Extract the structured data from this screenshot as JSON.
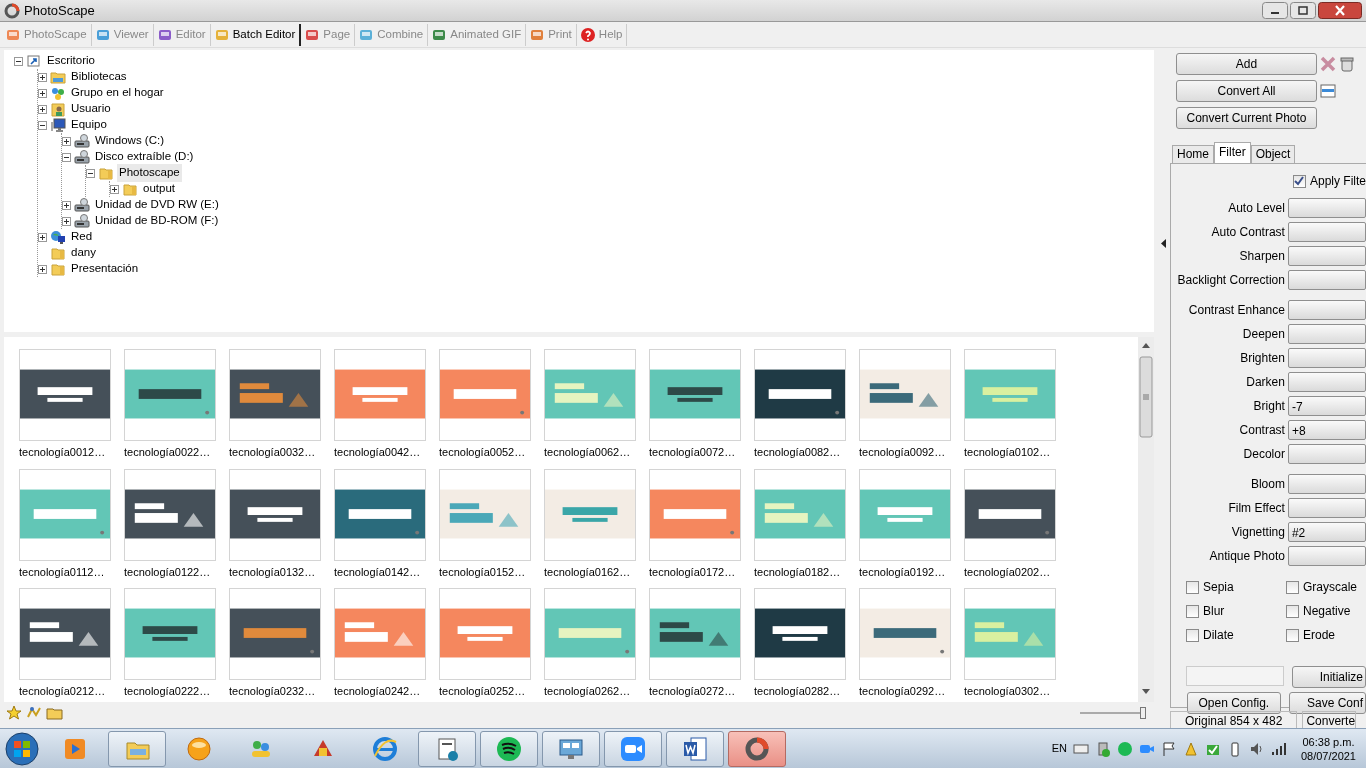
{
  "window": {
    "title": "PhotoScape"
  },
  "modules": [
    {
      "label": "PhotoScape",
      "selected": false
    },
    {
      "label": "Viewer",
      "selected": false
    },
    {
      "label": "Editor",
      "selected": false
    },
    {
      "label": "Batch Editor",
      "selected": true
    },
    {
      "label": "Page",
      "selected": false
    },
    {
      "label": "Combine",
      "selected": false
    },
    {
      "label": "Animated GIF",
      "selected": false
    },
    {
      "label": "Print",
      "selected": false
    },
    {
      "label": "Help",
      "selected": false
    }
  ],
  "tree": [
    {
      "label": "Escritorio",
      "kind": "desktop",
      "expanded": true,
      "selected": false,
      "children": [
        {
          "label": "Bibliotecas",
          "kind": "library",
          "expanded": false,
          "selected": false
        },
        {
          "label": "Grupo en el hogar",
          "kind": "homegroup",
          "expanded": false,
          "selected": false
        },
        {
          "label": "Usuario",
          "kind": "user",
          "expanded": false,
          "selected": false
        },
        {
          "label": "Equipo",
          "kind": "computer",
          "expanded": true,
          "selected": false,
          "children": [
            {
              "label": "Windows (C:)",
              "kind": "drive",
              "expanded": false,
              "selected": false
            },
            {
              "label": "Disco extraíble (D:)",
              "kind": "drive",
              "expanded": true,
              "selected": false,
              "children": [
                {
                  "label": "Photoscape",
                  "kind": "folder",
                  "expanded": true,
                  "selected": true,
                  "children": [
                    {
                      "label": "output",
                      "kind": "folder",
                      "expanded": false,
                      "selected": false
                    }
                  ]
                }
              ]
            },
            {
              "label": "Unidad de DVD RW (E:)",
              "kind": "drive",
              "expanded": false,
              "selected": false
            },
            {
              "label": "Unidad de BD-ROM (F:)",
              "kind": "drive",
              "expanded": false,
              "selected": false
            }
          ]
        },
        {
          "label": "Red",
          "kind": "network",
          "expanded": false,
          "selected": false
        },
        {
          "label": "dany",
          "kind": "folder",
          "selected": false
        },
        {
          "label": "Presentación",
          "kind": "folder",
          "expanded": false,
          "selected": false
        }
      ]
    }
  ],
  "thumbnails": [
    {
      "name": "tecnología0012…"
    },
    {
      "name": "tecnología0022…"
    },
    {
      "name": "tecnología0032…"
    },
    {
      "name": "tecnología0042…"
    },
    {
      "name": "tecnología0052…"
    },
    {
      "name": "tecnología0062…"
    },
    {
      "name": "tecnología0072…"
    },
    {
      "name": "tecnología0082…"
    },
    {
      "name": "tecnología0092…"
    },
    {
      "name": "tecnología0102…"
    },
    {
      "name": "tecnología0112…"
    },
    {
      "name": "tecnología0122…"
    },
    {
      "name": "tecnología0132…"
    },
    {
      "name": "tecnología0142…"
    },
    {
      "name": "tecnología0152…"
    },
    {
      "name": "tecnología0162…"
    },
    {
      "name": "tecnología0172…"
    },
    {
      "name": "tecnología0182…"
    },
    {
      "name": "tecnología0192…"
    },
    {
      "name": "tecnología0202…"
    },
    {
      "name": "tecnología0212…"
    },
    {
      "name": "tecnología0222…"
    },
    {
      "name": "tecnología0232…"
    },
    {
      "name": "tecnología0242…"
    },
    {
      "name": "tecnología0252…"
    },
    {
      "name": "tecnología0262…"
    },
    {
      "name": "tecnología0272…"
    },
    {
      "name": "tecnología0282…"
    },
    {
      "name": "tecnología0292…"
    },
    {
      "name": "tecnología0302…"
    }
  ],
  "zoom_slider": {
    "level": 1
  },
  "actions": [
    "Add",
    "Convert All",
    "Convert Current Photo"
  ],
  "panel_tabs": [
    {
      "label": "Home",
      "selected": false
    },
    {
      "label": "Filter",
      "selected": true
    },
    {
      "label": "Object",
      "selected": false
    }
  ],
  "apply_filter": {
    "label": "Apply Filte",
    "checked": true
  },
  "filter_groups": [
    [
      {
        "label": "Auto Level"
      },
      {
        "label": "Auto Contrast"
      },
      {
        "label": "Sharpen"
      },
      {
        "label": "Backlight Correction"
      }
    ],
    [
      {
        "label": "Contrast Enhance"
      },
      {
        "label": "Deepen"
      },
      {
        "label": "Brighten"
      },
      {
        "label": "Darken"
      },
      {
        "label": "Bright",
        "value": "-7"
      },
      {
        "label": "Contrast",
        "value": "+8"
      },
      {
        "label": "Decolor"
      }
    ],
    [
      {
        "label": "Bloom"
      },
      {
        "label": "Film Effect"
      },
      {
        "label": "Vignetting",
        "value": "#2"
      },
      {
        "label": "Antique Photo"
      }
    ]
  ],
  "effects": [
    {
      "label": "Sepia",
      "checked": false
    },
    {
      "label": "Grayscale",
      "checked": false
    },
    {
      "label": "Blur",
      "checked": false
    },
    {
      "label": "Negative",
      "checked": false
    },
    {
      "label": "Dilate",
      "checked": false
    },
    {
      "label": "Erode",
      "checked": false
    }
  ],
  "config_buttons": [
    "Initialize",
    "Open Config.",
    "Save Conf"
  ],
  "status_bar": [
    "Original 854 x 482",
    "Converte"
  ],
  "taskbar": {
    "items": [
      {
        "framed": false,
        "selected": false
      },
      {
        "framed": true,
        "selected": false
      },
      {
        "framed": false,
        "selected": false
      },
      {
        "framed": false,
        "selected": false
      },
      {
        "framed": false,
        "selected": false
      },
      {
        "framed": false,
        "selected": false
      },
      {
        "framed": true,
        "selected": false
      },
      {
        "framed": true,
        "selected": false
      },
      {
        "framed": true,
        "selected": false
      },
      {
        "framed": true,
        "selected": false
      },
      {
        "framed": true,
        "selected": false
      },
      {
        "framed": true,
        "selected": true
      }
    ],
    "language": "EN",
    "time": "06:38 p.m.",
    "date": "08/07/2021"
  }
}
